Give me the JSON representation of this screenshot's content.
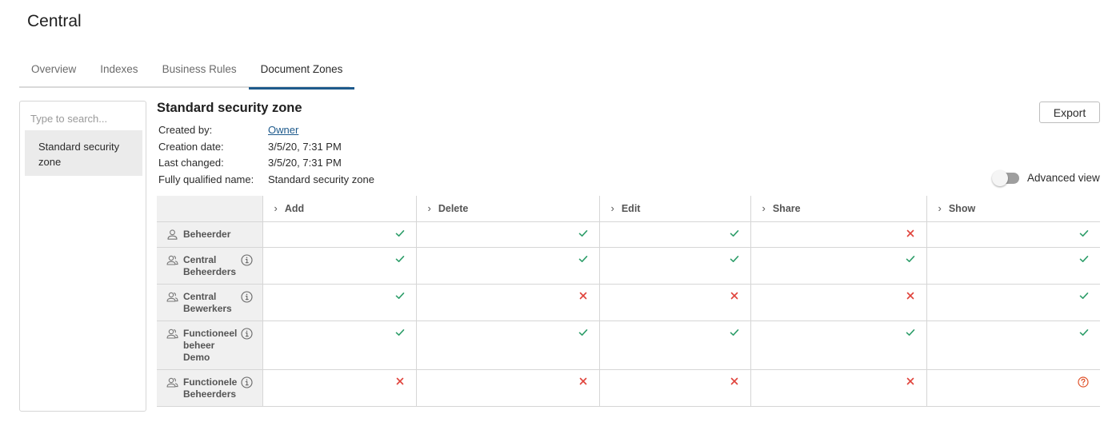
{
  "app": {
    "title": "Central"
  },
  "tabs": [
    {
      "label": "Overview",
      "active": false
    },
    {
      "label": "Indexes",
      "active": false
    },
    {
      "label": "Business Rules",
      "active": false
    },
    {
      "label": "Document Zones",
      "active": true
    }
  ],
  "sidebar": {
    "search_placeholder": "Type to search...",
    "items": [
      {
        "label": "Standard security zone",
        "selected": true
      }
    ]
  },
  "zone": {
    "title": "Standard security zone",
    "meta": [
      {
        "label": "Created by:",
        "value": "Owner",
        "link": true
      },
      {
        "label": "Creation date:",
        "value": "3/5/20, 7:31 PM"
      },
      {
        "label": "Last changed:",
        "value": "3/5/20, 7:31 PM"
      },
      {
        "label": "Fully qualified name:",
        "value": "Standard security zone"
      }
    ]
  },
  "export_label": "Export",
  "advanced_view": {
    "label": "Advanced view",
    "on": false
  },
  "permissions": {
    "columns": [
      "Add",
      "Delete",
      "Edit",
      "Share",
      "Show"
    ],
    "rows": [
      {
        "name": [
          "Beheerder"
        ],
        "type": "user",
        "info": false,
        "values": [
          "allow",
          "allow",
          "allow",
          "deny",
          "allow"
        ]
      },
      {
        "name": [
          "Central",
          "Beheerders"
        ],
        "type": "group",
        "info": true,
        "values": [
          "allow",
          "allow",
          "allow",
          "allow",
          "allow"
        ]
      },
      {
        "name": [
          "Central",
          "Bewerkers"
        ],
        "type": "group",
        "info": true,
        "values": [
          "allow",
          "deny",
          "deny",
          "deny",
          "allow"
        ]
      },
      {
        "name": [
          "Functioneel",
          "beheer",
          "Demo"
        ],
        "type": "group",
        "info": true,
        "values": [
          "allow",
          "allow",
          "allow",
          "allow",
          "allow"
        ]
      },
      {
        "name": [
          "Functionele",
          "Beheerders"
        ],
        "type": "group",
        "info": true,
        "values": [
          "deny",
          "deny",
          "deny",
          "deny",
          "unknown"
        ]
      }
    ]
  },
  "colors": {
    "accent": "#1e5a8c",
    "allow": "#2e9e6a",
    "deny": "#e0433b",
    "unknown": "#e0532b"
  }
}
